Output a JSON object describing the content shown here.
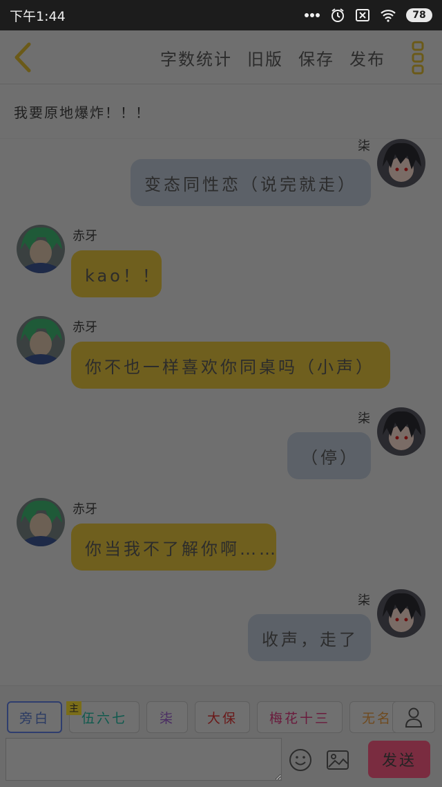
{
  "status_bar": {
    "time": "下午1:44",
    "battery": "78"
  },
  "toolbar": {
    "actions": [
      "字数统计",
      "旧版",
      "保存",
      "发布"
    ]
  },
  "chapter": {
    "title": "我要原地爆炸！！！"
  },
  "messages": [
    {
      "side": "right",
      "sender": "柒",
      "text": "变态同性恋（说完就走）"
    },
    {
      "side": "left",
      "sender": "赤牙",
      "text": "kao！！"
    },
    {
      "side": "left",
      "sender": "赤牙",
      "text": "你不也一样喜欢你同桌吗（小声）"
    },
    {
      "side": "right",
      "sender": "柒",
      "text": "（停）"
    },
    {
      "side": "left",
      "sender": "赤牙",
      "text": "你当我不了解你啊……"
    },
    {
      "side": "right",
      "sender": "柒",
      "text": "收声，走了"
    }
  ],
  "roles": {
    "main_badge": "主",
    "items": [
      {
        "label": "旁白",
        "color": "#2a3a63"
      },
      {
        "label": "伍六七",
        "color": "#0f5a4e"
      },
      {
        "label": "柒",
        "color": "#4a2c63"
      },
      {
        "label": "大保",
        "color": "#6a1818"
      },
      {
        "label": "梅花十三",
        "color": "#6a1a3c"
      },
      {
        "label": "无名",
        "color": "#6f4a1e"
      }
    ]
  },
  "composer": {
    "input_value": "",
    "send_label": "发送"
  },
  "colors": {
    "right_bubble": "#5c6168",
    "left_bubble": "#6f5f1e",
    "send_button": "#7a2c40"
  }
}
